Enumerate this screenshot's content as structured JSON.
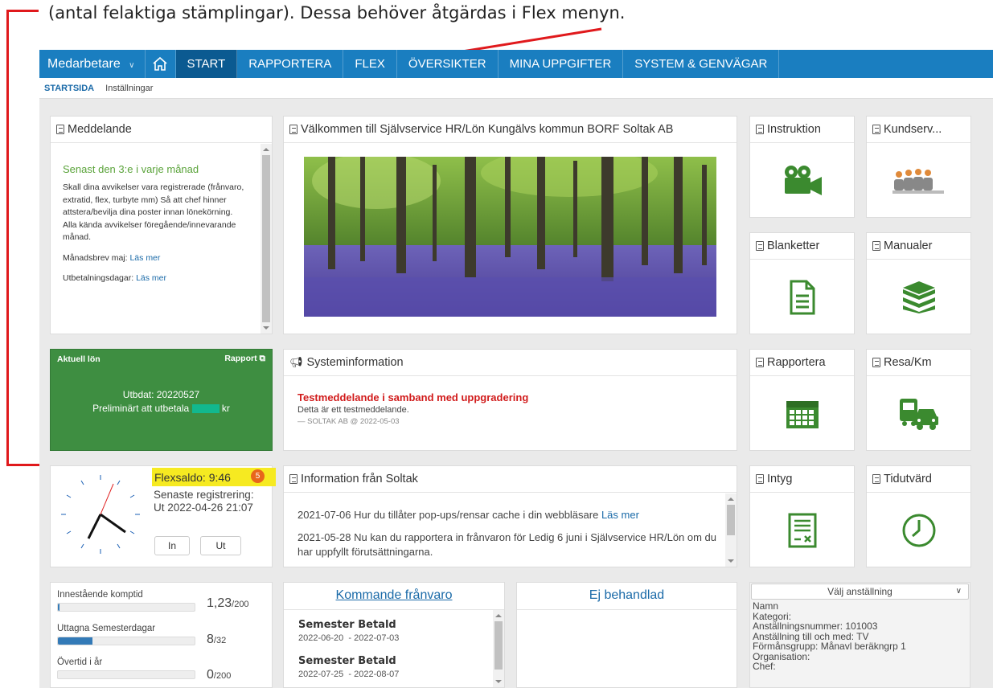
{
  "caption": "(antal felaktiga stämplingar).  Dessa behöver åtgärdas i Flex menyn.",
  "topnav": {
    "employee_menu": "Medarbetare",
    "items": [
      "START",
      "RAPPORTERA",
      "FLEX",
      "ÖVERSIKTER",
      "MINA UPPGIFTER",
      "SYSTEM & GENVÄGAR"
    ]
  },
  "subnav": {
    "active": "STARTSIDA",
    "item": "Inställningar"
  },
  "meddelande": {
    "title": "Meddelande",
    "heading": "Senast den 3:e i varje månad",
    "body": "Skall dina avvikelser vara registrerade (frånvaro, extratid, flex, turbyte mm) Så att chef hinner attstera/bevilja dina poster innan lönekörning. Alla kända avvikelser föregående/innevarande månad.",
    "manadsbrev_label": "Månadsbrev maj:",
    "manadsbrev_link": "Läs mer",
    "utbetalning_label": "Utbetalningsdagar:",
    "utbetalning_link": "Läs mer"
  },
  "valkommen": {
    "title": "Välkommen till Självservice HR/Lön Kungälvs kommun BORF Soltak AB"
  },
  "tiles": {
    "instruktion": "Instruktion",
    "kundservice": "Kundserv...",
    "blanketter": "Blanketter",
    "manualer": "Manualer",
    "rapportera": "Rapportera",
    "resa": "Resa/Km",
    "intyg": "Intyg",
    "tidutvard": "Tidutvärd"
  },
  "lon": {
    "title": "Aktuell lön",
    "rapport": "Rapport",
    "utbdat": "Utbdat: 20220527",
    "prelim": "Preliminärt att utbetala",
    "kr": "kr"
  },
  "systeminfo": {
    "title": "Systeminformation",
    "heading": "Testmeddelande i samband med uppgradering",
    "body": "Detta är ett testmeddelande.",
    "meta": "— SOLTAK AB @ 2022-05-03"
  },
  "flex": {
    "saldo": "Flexsaldo: 9:46",
    "badge": "5",
    "senaste_label": "Senaste registrering:",
    "senaste_value": "Ut 2022-04-26 21:07",
    "in_label": "In",
    "ut_label": "Ut"
  },
  "soltak_info": {
    "title": "Information från Soltak",
    "item1_text": "2021-07-06 Hur du tillåter pop-ups/rensar cache i din webbläsare",
    "item1_link": "Läs mer",
    "item2_text": "2021-05-28 Nu kan du rapportera in frånvaron för Ledig 6 juni i Självservice HR/Lön om du har uppfyllt förutsättningarna."
  },
  "saldon": [
    {
      "label": "Innestående komptid",
      "value": "1,23",
      "max": "/200",
      "fraction": 0.006
    },
    {
      "label": "Uttagna Semesterdagar",
      "value": "8",
      "max": "/32",
      "fraction": 0.25
    },
    {
      "label": "Övertid i år",
      "value": "0",
      "max": "/200",
      "fraction": 0
    }
  ],
  "franvaro": {
    "title": "Kommande frånvaro",
    "items": [
      {
        "type": "Semester Betald",
        "dates": "2022-06-20  - 2022-07-03"
      },
      {
        "type": "Semester Betald",
        "dates": "2022-07-25  - 2022-08-07"
      }
    ]
  },
  "ej_behandlad": {
    "title": "Ej behandlad"
  },
  "anstallning": {
    "select": "Välj anställning",
    "lines": [
      "Namn",
      "Kategori:",
      "Anställningsnummer: 101003",
      "Anställning till och med: TV",
      "Förmånsgrupp: Månavl beräkngrp 1",
      "Organisation:",
      "Chef:"
    ]
  },
  "colors": {
    "nav_blue": "#1a7ec0",
    "green": "#3e8e41",
    "icon_green": "#3b8a2f",
    "red": "#e0191c",
    "highlight": "#f6ea21"
  }
}
